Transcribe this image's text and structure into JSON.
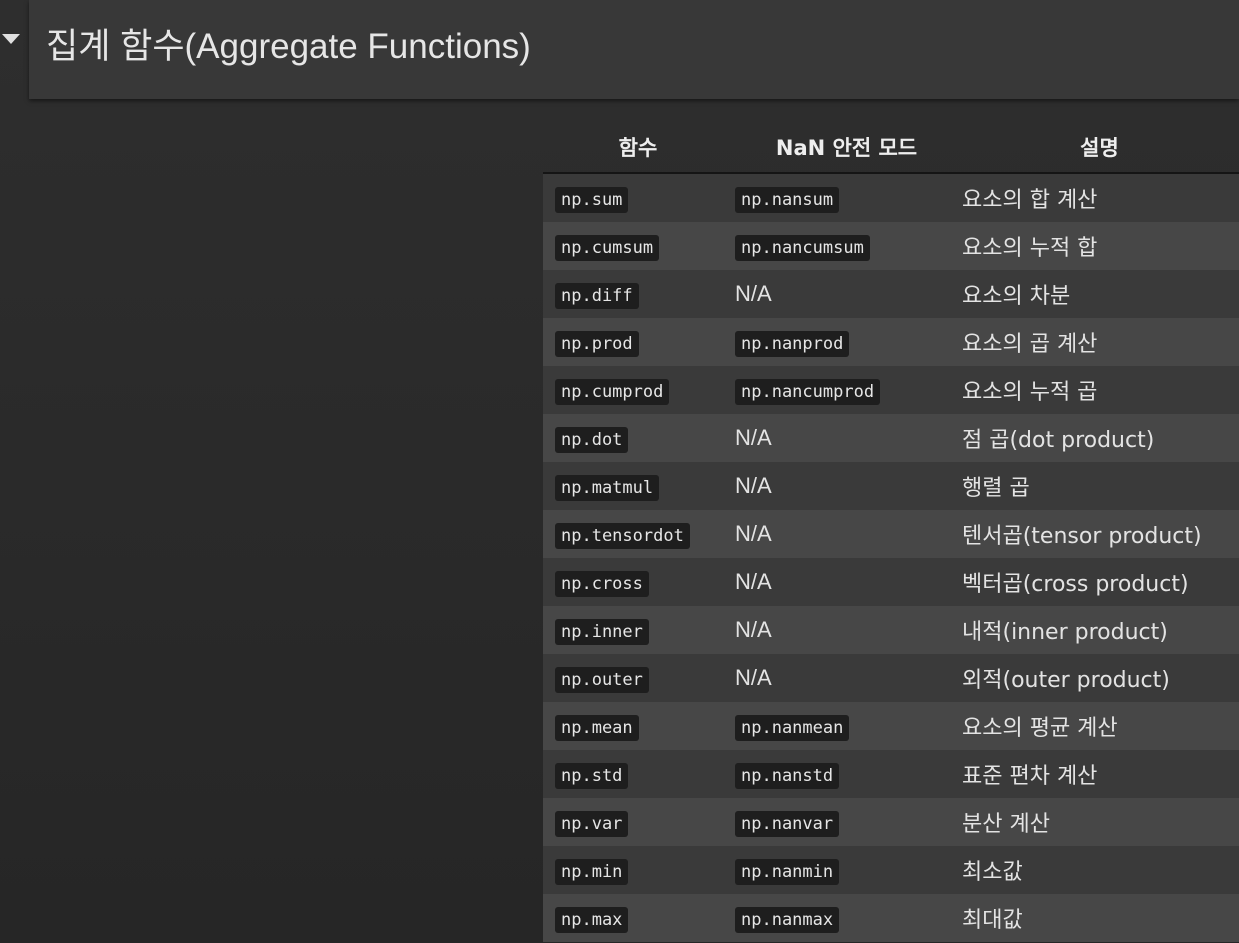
{
  "section": {
    "title": "집계 함수(Aggregate Functions)"
  },
  "table": {
    "headers": [
      "함수",
      "NaN 안전 모드",
      "설명"
    ],
    "rows": [
      [
        "np.sum",
        "np.nansum",
        "요소의 합 계산"
      ],
      [
        "np.cumsum",
        "np.nancumsum",
        "요소의 누적 합"
      ],
      [
        "np.diff",
        "N/A",
        "요소의 차분"
      ],
      [
        "np.prod",
        "np.nanprod",
        "요소의 곱 계산"
      ],
      [
        "np.cumprod",
        "np.nancumprod",
        "요소의 누적 곱"
      ],
      [
        "np.dot",
        "N/A",
        "점 곱(dot product)"
      ],
      [
        "np.matmul",
        "N/A",
        "행렬 곱"
      ],
      [
        "np.tensordot",
        "N/A",
        "텐서곱(tensor product)"
      ],
      [
        "np.cross",
        "N/A",
        "벡터곱(cross product)"
      ],
      [
        "np.inner",
        "N/A",
        "내적(inner product)"
      ],
      [
        "np.outer",
        "N/A",
        "외적(outer product)"
      ],
      [
        "np.mean",
        "np.nanmean",
        "요소의 평균 계산"
      ],
      [
        "np.std",
        "np.nanstd",
        "표준 편차 계산"
      ],
      [
        "np.var",
        "np.nanvar",
        "분산 계산"
      ],
      [
        "np.min",
        "np.nanmin",
        "최소값"
      ],
      [
        "np.max",
        "np.nanmax",
        "최대값"
      ]
    ]
  }
}
